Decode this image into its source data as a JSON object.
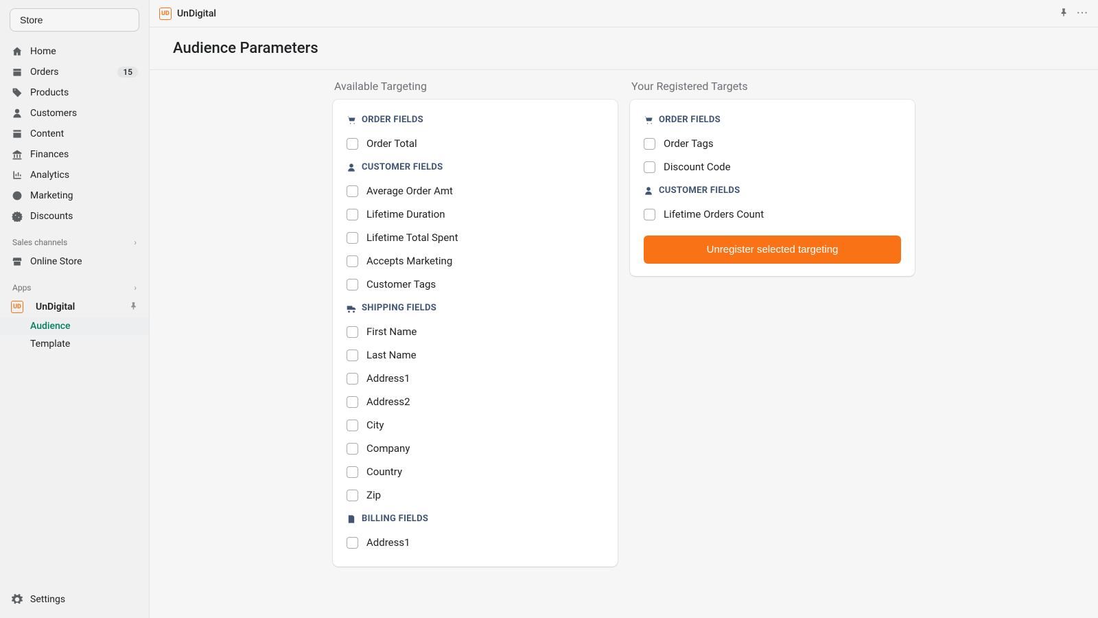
{
  "sidebar": {
    "store_button": "Store",
    "nav": [
      {
        "label": "Home",
        "icon": "home"
      },
      {
        "label": "Orders",
        "icon": "orders",
        "badge": "15"
      },
      {
        "label": "Products",
        "icon": "tag"
      },
      {
        "label": "Customers",
        "icon": "person"
      },
      {
        "label": "Content",
        "icon": "content"
      },
      {
        "label": "Finances",
        "icon": "bank"
      },
      {
        "label": "Analytics",
        "icon": "chart"
      },
      {
        "label": "Marketing",
        "icon": "target"
      },
      {
        "label": "Discounts",
        "icon": "discount"
      }
    ],
    "sales_channels_label": "Sales channels",
    "online_store": "Online Store",
    "apps_label": "Apps",
    "app_name": "UnDigital",
    "app_sub": [
      {
        "label": "Audience",
        "active": true
      },
      {
        "label": "Template",
        "active": false
      }
    ],
    "settings": "Settings"
  },
  "topbar": {
    "app_name": "UnDigital"
  },
  "page": {
    "title": "Audience Parameters"
  },
  "columns": {
    "available_title": "Available Targeting",
    "registered_title": "Your Registered Targets"
  },
  "available": {
    "groups": {
      "order_fields": "ORDER FIELDS",
      "customer_fields": "CUSTOMER FIELDS",
      "shipping_fields": "SHIPPING FIELDS",
      "billing_fields": "BILLING FIELDS"
    },
    "order": [
      "Order Total"
    ],
    "customer": [
      "Average Order Amt",
      "Lifetime Duration",
      "Lifetime Total Spent",
      "Accepts Marketing",
      "Customer Tags"
    ],
    "shipping": [
      "First Name",
      "Last Name",
      "Address1",
      "Address2",
      "City",
      "Company",
      "Country",
      "Zip"
    ],
    "billing": [
      "Address1"
    ]
  },
  "registered": {
    "groups": {
      "order_fields": "ORDER FIELDS",
      "customer_fields": "CUSTOMER FIELDS"
    },
    "order": [
      "Order Tags",
      "Discount Code"
    ],
    "customer": [
      "Lifetime Orders Count"
    ],
    "button": "Unregister selected targeting"
  }
}
